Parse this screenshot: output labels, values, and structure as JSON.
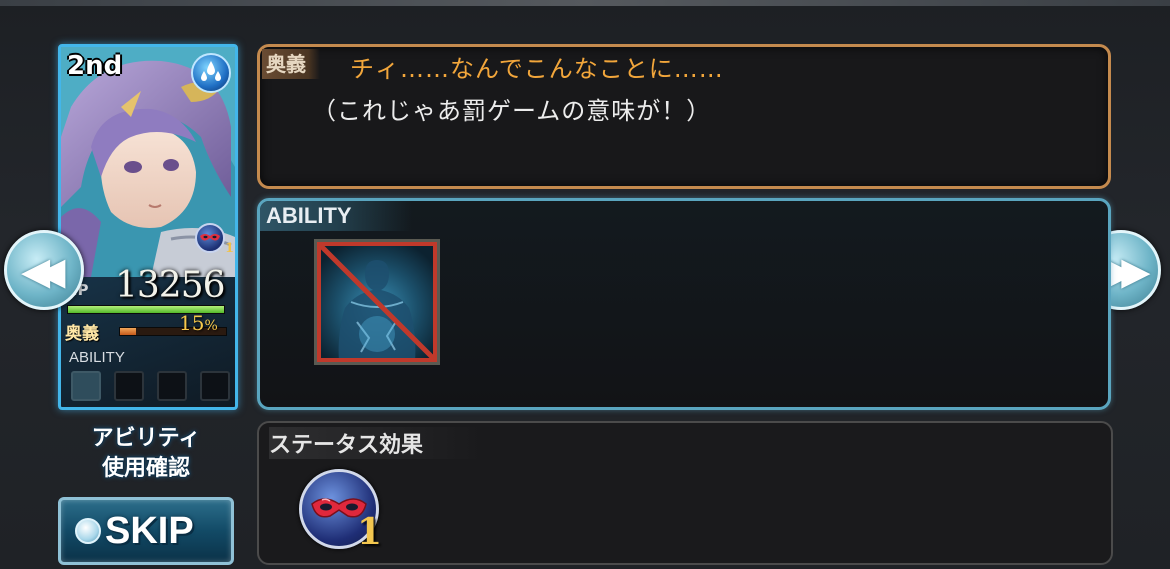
{
  "character": {
    "order": "2nd",
    "element_icon": "water-drops-icon",
    "status_icon_count": "1",
    "hp_label": "HP",
    "hp_value": "13256",
    "hp_fraction": 1.0,
    "ougi_label": "奥義",
    "ougi_percent": "15",
    "ougi_percent_unit": "%",
    "ougi_fraction": 0.15,
    "ability_label": "ABILITY",
    "ability_slots_filled": 1
  },
  "ougi": {
    "tag": "奥義",
    "name": "チィ……なんでこんなことに……",
    "description": "（これじゃあ罰ゲームの意味が！）"
  },
  "ability": {
    "header": "ABILITY",
    "icon": "sealed-body-icon"
  },
  "status": {
    "header": "ステータス効果",
    "icon": "red-mask-icon",
    "count": "1"
  },
  "controls": {
    "confirm_line1": "アビリティ",
    "confirm_line2": "使用確認",
    "skip_label": "SKIP",
    "prev_icon": "double-chevron-left-icon",
    "next_icon": "double-chevron-right-icon"
  },
  "colors": {
    "card_border": "#43b6ea",
    "ougi_name": "#f2a63b",
    "ougi_panel_border": "#c48a4e",
    "ability_panel_border": "#5aa5bf",
    "hp_bar": "#53b92a",
    "ougi_bar": "#c5591b",
    "status_count": "#f2c64f"
  }
}
